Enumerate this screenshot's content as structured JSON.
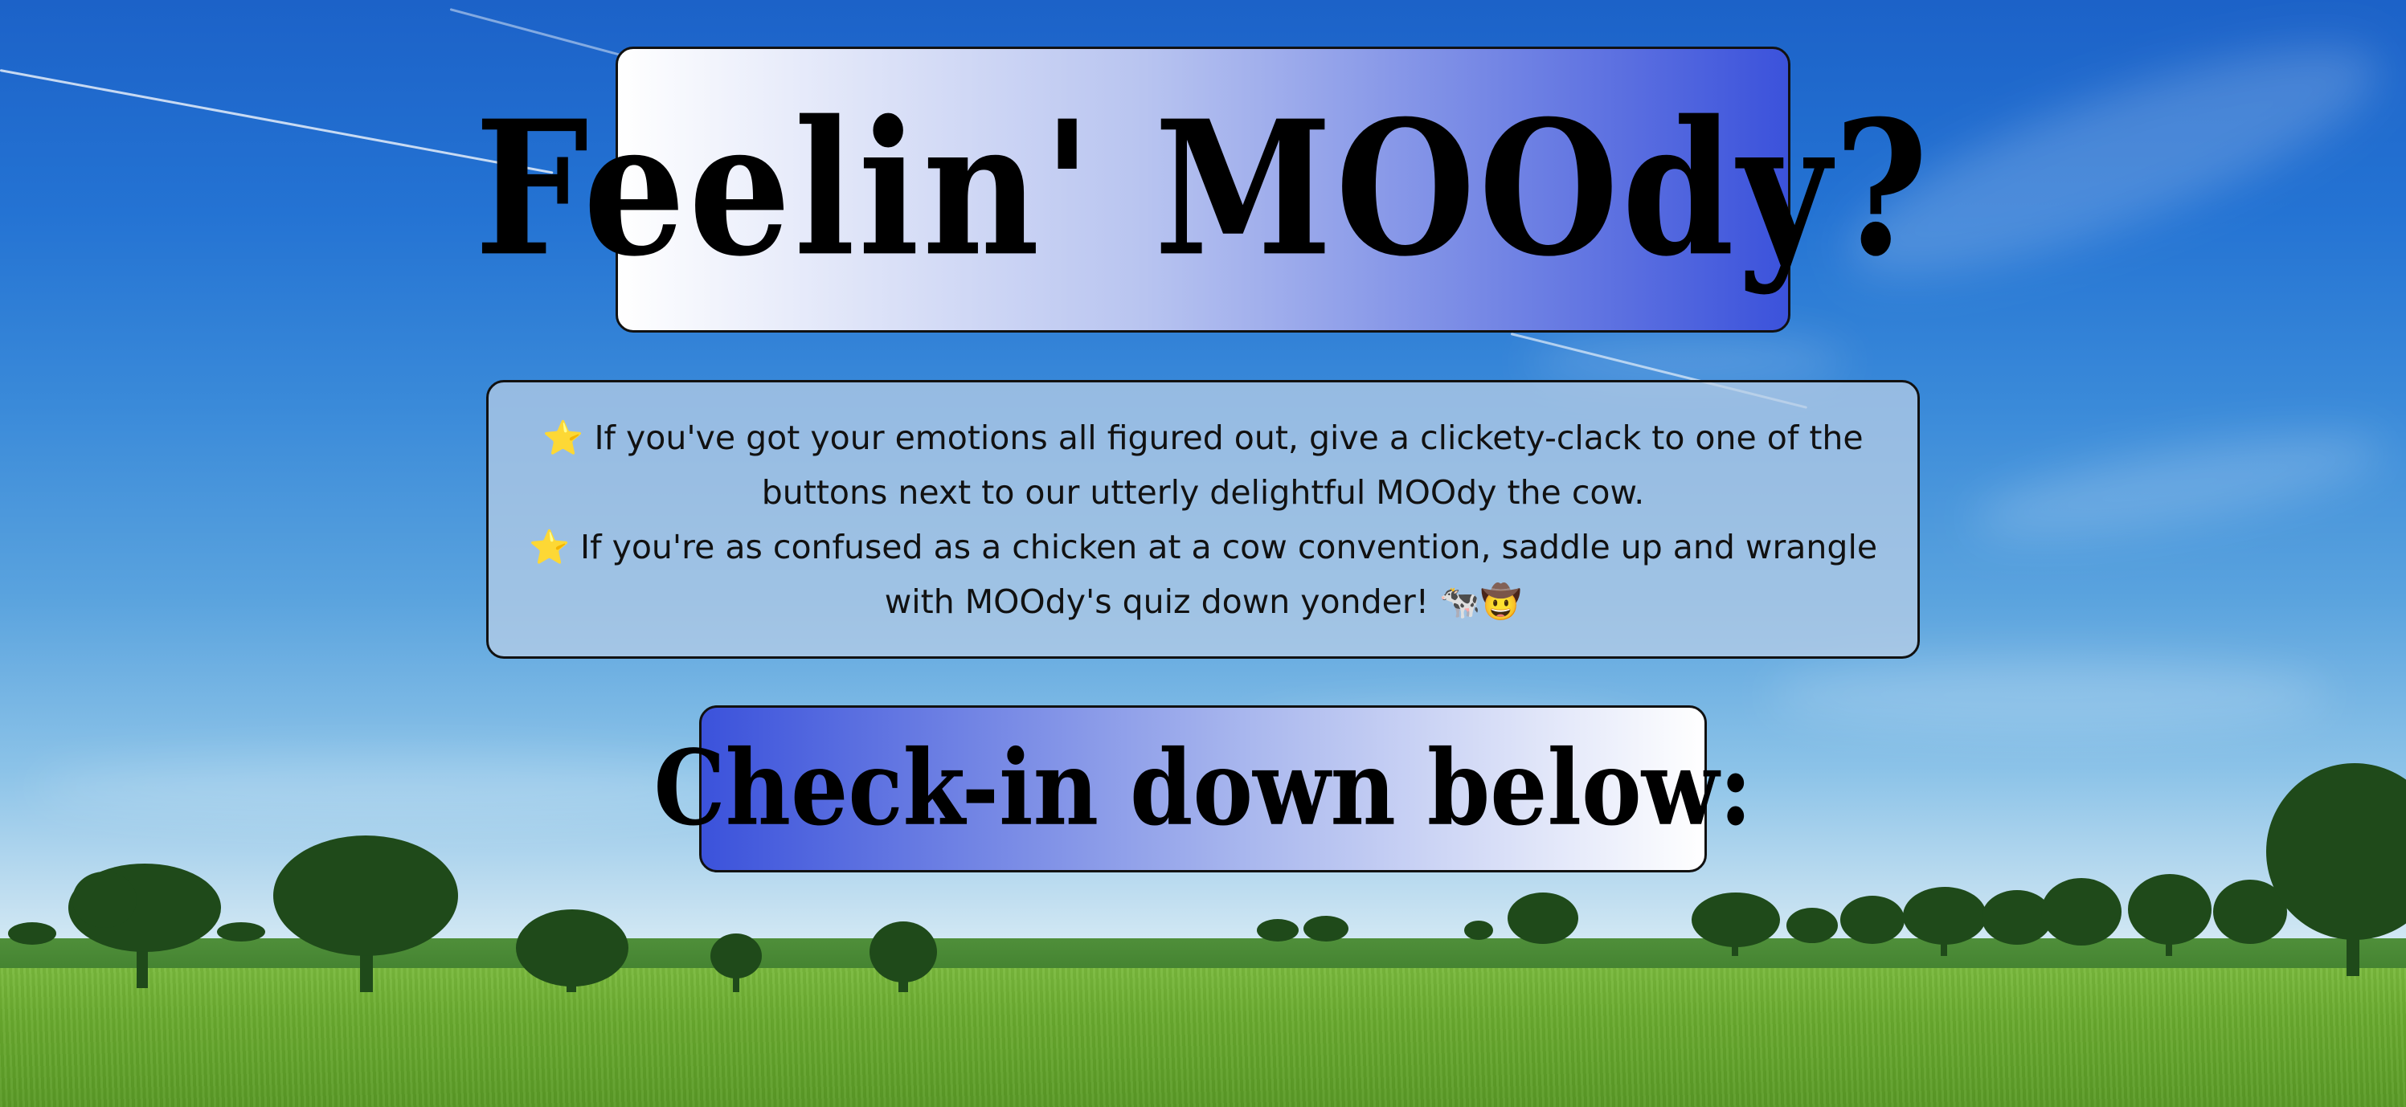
{
  "header": {
    "title": "Feelin' MOOdy?"
  },
  "intro": {
    "lines": [
      "⭐ If you've got your emotions all figured out, give a clickety-clack to one of the",
      "buttons next to our utterly delightful MOOdy the cow.",
      "⭐ If you're as confused as a chicken at a cow convention, saddle up and wrangle",
      "with MOOdy's quiz down yonder! 🐄🤠"
    ]
  },
  "checkin": {
    "label": "Check-in down below:"
  }
}
